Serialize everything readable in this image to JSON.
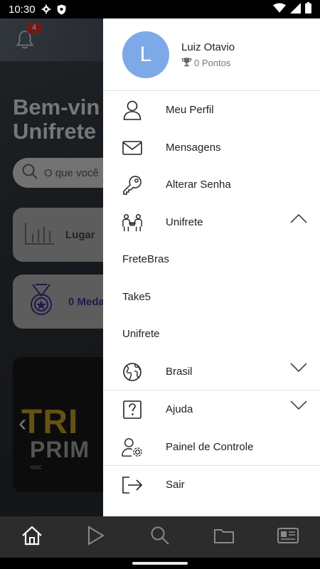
{
  "status_bar": {
    "time": "10:30"
  },
  "background_app": {
    "notification_count": "4",
    "welcome_text_line1": "Bem-vin",
    "welcome_text_line2": "Unifrete",
    "search_placeholder": "O que você",
    "card_ranking_label": "Lugar",
    "card_medals_label": "0 Medal",
    "banner_text_line1": "TRI",
    "banner_text_line2": "PRIM",
    "banner_chevrons": "<<<"
  },
  "drawer": {
    "user_initial": "L",
    "user_name": "Luiz Otavio",
    "user_points": "0 Pontos",
    "menu": {
      "profile": "Meu Perfil",
      "messages": "Mensagens",
      "change_password": "Alterar Senha",
      "unifrete": "Unifrete",
      "unifrete_sub": [
        "FreteBras",
        "Take5",
        "Unifrete"
      ],
      "country": "Brasil",
      "help": "Ajuda",
      "control_panel": "Painel de Controle",
      "logout": "Sair"
    }
  },
  "bottom_nav": {
    "icons": [
      "home-icon",
      "play-icon",
      "search-icon",
      "folder-icon",
      "news-icon"
    ]
  },
  "colors": {
    "avatar": "#7ea9e8",
    "badge": "#d32f2f",
    "drawer_bg": "#ffffff"
  }
}
